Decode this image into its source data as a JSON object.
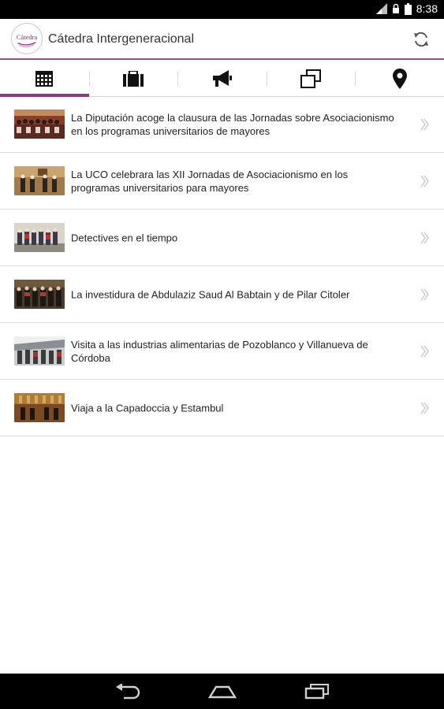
{
  "status_bar": {
    "time": "8:38"
  },
  "app": {
    "title": "Cátedra Intergeneracional",
    "accent": "#8c3a7e"
  },
  "tabs": [
    {
      "name": "calendar-icon",
      "active": true
    },
    {
      "name": "briefcase-icon",
      "active": false
    },
    {
      "name": "megaphone-icon",
      "active": false
    },
    {
      "name": "gallery-icon",
      "active": false
    },
    {
      "name": "location-pin-icon",
      "active": false
    }
  ],
  "news": [
    {
      "title": "La Diputación acoge la clausura de las Jornadas sobre Asociacionismo en los programas universitarios de mayores"
    },
    {
      "title": "La UCO celebrara las XII Jornadas de Asociacionismo en los programas universitarios para mayores"
    },
    {
      "title": "Detectives en el tiempo"
    },
    {
      "title": "La investidura de Abdulaziz Saud Al Babtain y de Pilar Citoler"
    },
    {
      "title": "Visita a las industrias alimentarias de Pozoblanco y Villanueva de Córdoba"
    },
    {
      "title": "Viaja a la Capadoccia y Estambul"
    }
  ],
  "logo": {
    "text": "Cátedra"
  }
}
